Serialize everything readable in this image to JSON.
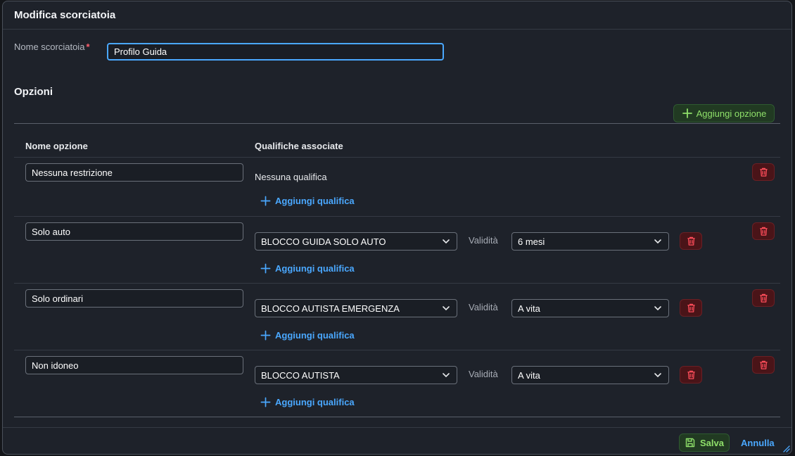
{
  "dialog": {
    "title": "Modifica scorciatoia"
  },
  "shortcut_name": {
    "label": "Nome scorciatoia",
    "required_mark": "*",
    "value": "Profilo Guida"
  },
  "options_section": {
    "title": "Opzioni",
    "add_option_label": "Aggiungi opzione",
    "columns": {
      "name": "Nome opzione",
      "qualifications": "Qualifiche associate"
    },
    "validity_label": "Validità",
    "add_qualification_label": "Aggiungi qualifica",
    "no_qualification_text": "Nessuna qualifica",
    "rows": [
      {
        "name": "Nessuna restrizione",
        "qualification": "",
        "validity": ""
      },
      {
        "name": "Solo auto",
        "qualification": "BLOCCO GUIDA SOLO AUTO",
        "validity": "6 mesi"
      },
      {
        "name": "Solo ordinari",
        "qualification": "BLOCCO AUTISTA EMERGENZA",
        "validity": "A vita"
      },
      {
        "name": "Non idoneo",
        "qualification": "BLOCCO AUTISTA",
        "validity": "A vita"
      }
    ]
  },
  "footer": {
    "save_label": "Salva",
    "cancel_label": "Annulla"
  },
  "colors": {
    "accent_blue": "#4aa8ff",
    "success_green": "#8fe06a",
    "danger_red": "#ff4d5a",
    "background": "#1e222a"
  }
}
